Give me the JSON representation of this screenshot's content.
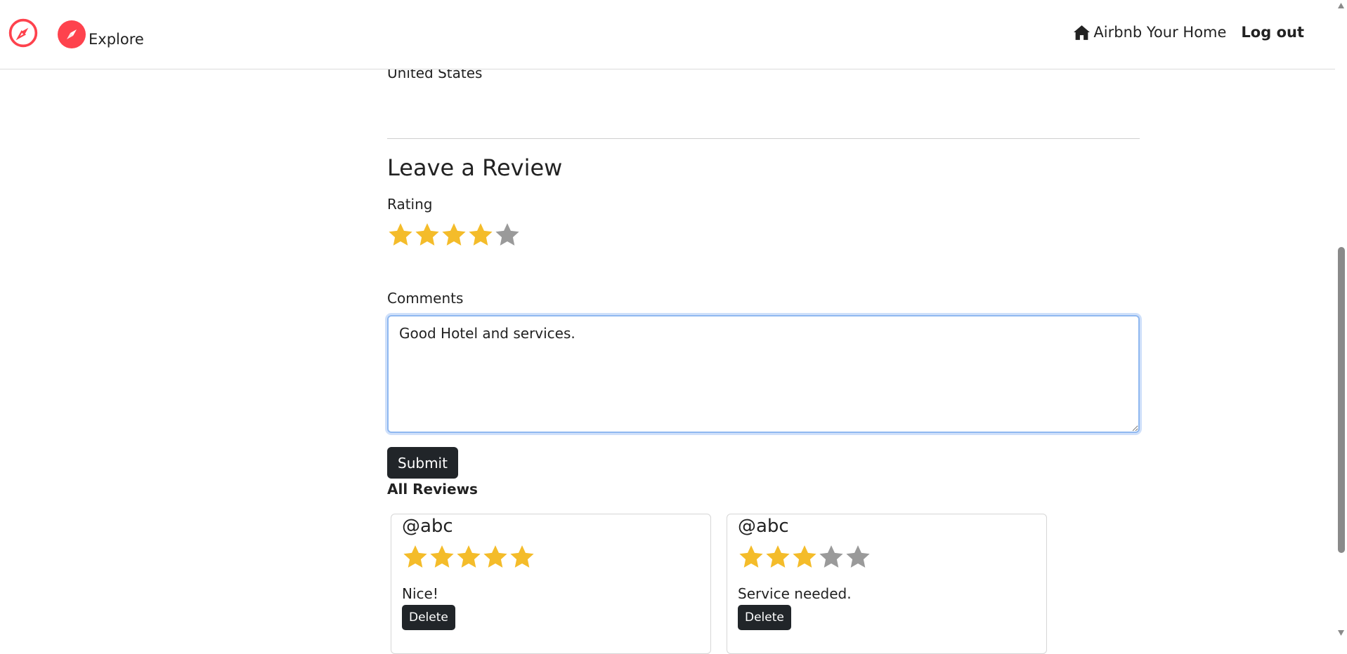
{
  "nav": {
    "explore_label": "Explore",
    "home_label": "Airbnb Your Home",
    "logout_label": "Log out"
  },
  "colors": {
    "brand": "#fe424d",
    "star_filled": "#f4bc2a",
    "star_empty": "#9a9a9a",
    "button_dark": "#212529"
  },
  "icons": {
    "logo": "compass-icon",
    "explore": "compass-icon",
    "home": "home-icon"
  },
  "listing": {
    "country": "United States"
  },
  "review_form": {
    "heading": "Leave a Review",
    "rating_label": "Rating",
    "rating_value": 4,
    "rating_max": 5,
    "comments_label": "Comments",
    "comments_value": "Good Hotel and services.",
    "submit_label": "Submit"
  },
  "reviews": {
    "heading": "All Reviews",
    "items": [
      {
        "author": "@abc",
        "rating": 5,
        "comment": "Nice!",
        "delete_label": "Delete"
      },
      {
        "author": "@abc",
        "rating": 3,
        "comment": "Service needed.",
        "delete_label": "Delete"
      }
    ]
  }
}
